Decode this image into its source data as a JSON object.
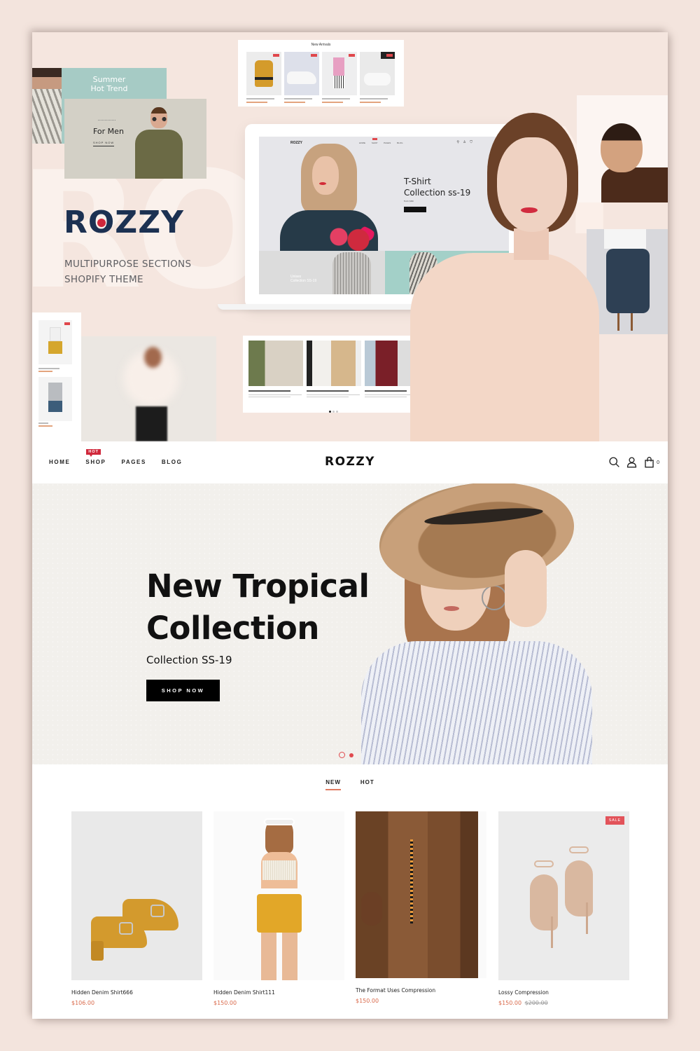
{
  "collage": {
    "background_letters": "RO",
    "summer_card": {
      "title_line1": "Summer",
      "title_line2": "Hot Trend"
    },
    "men_card": {
      "title": "For Men",
      "cta": "SHOP NOW"
    },
    "brand": {
      "name_before_o": "R",
      "name_after_o": "ZZY",
      "o": "O",
      "tagline_line1": "MULTIPURPOSE SECTIONS",
      "tagline_line2": "SHOPIFY THEME",
      "accent_color": "#d0283b",
      "brand_color": "#1c3152"
    },
    "arrivals_card": {
      "heading": "New Arrivals"
    },
    "laptop": {
      "logo": "ROZZY",
      "nav": "HOME SHOP PAGES BLOG",
      "icons": "⚲ ♙ ⛉",
      "hero_line1": "T-Shirt",
      "hero_line2": "Collection ss-19",
      "hero_sub": "from $60",
      "lower_left_line1": "Unisex",
      "lower_left_line2": "Collection SS-19"
    }
  },
  "store": {
    "nav": {
      "items": [
        {
          "label": "HOME"
        },
        {
          "label": "SHOP",
          "badge": "HOT"
        },
        {
          "label": "PAGES"
        },
        {
          "label": "BLOG"
        }
      ],
      "logo": "ROZZY",
      "cart_count": "0",
      "icons": [
        "search-icon",
        "user-icon",
        "cart-icon"
      ]
    },
    "hero": {
      "title_line1": "New Tropical",
      "title_line2": "Collection",
      "subtitle": "Collection SS-19",
      "button": "SHOP NOW",
      "slides": 2,
      "active_slide": 1
    },
    "tabs": [
      {
        "label": "NEW",
        "active": true
      },
      {
        "label": "HOT",
        "active": false
      }
    ],
    "products": [
      {
        "name": "Hidden Denim Shirt666",
        "price": "$106.00",
        "old_price": null,
        "badge": null
      },
      {
        "name": "Hidden Denim Shirt111",
        "price": "$150.00",
        "old_price": null,
        "badge": null
      },
      {
        "name": "The Format Uses Compression",
        "price": "$150.00",
        "old_price": null,
        "badge": null
      },
      {
        "name": "Lossy Compression",
        "price": "$150.00",
        "old_price": "$200.00",
        "badge": "SALE"
      }
    ],
    "colors": {
      "accent": "#d9694a",
      "badge_red": "#e2535a",
      "hot_red": "#d0283b"
    }
  }
}
